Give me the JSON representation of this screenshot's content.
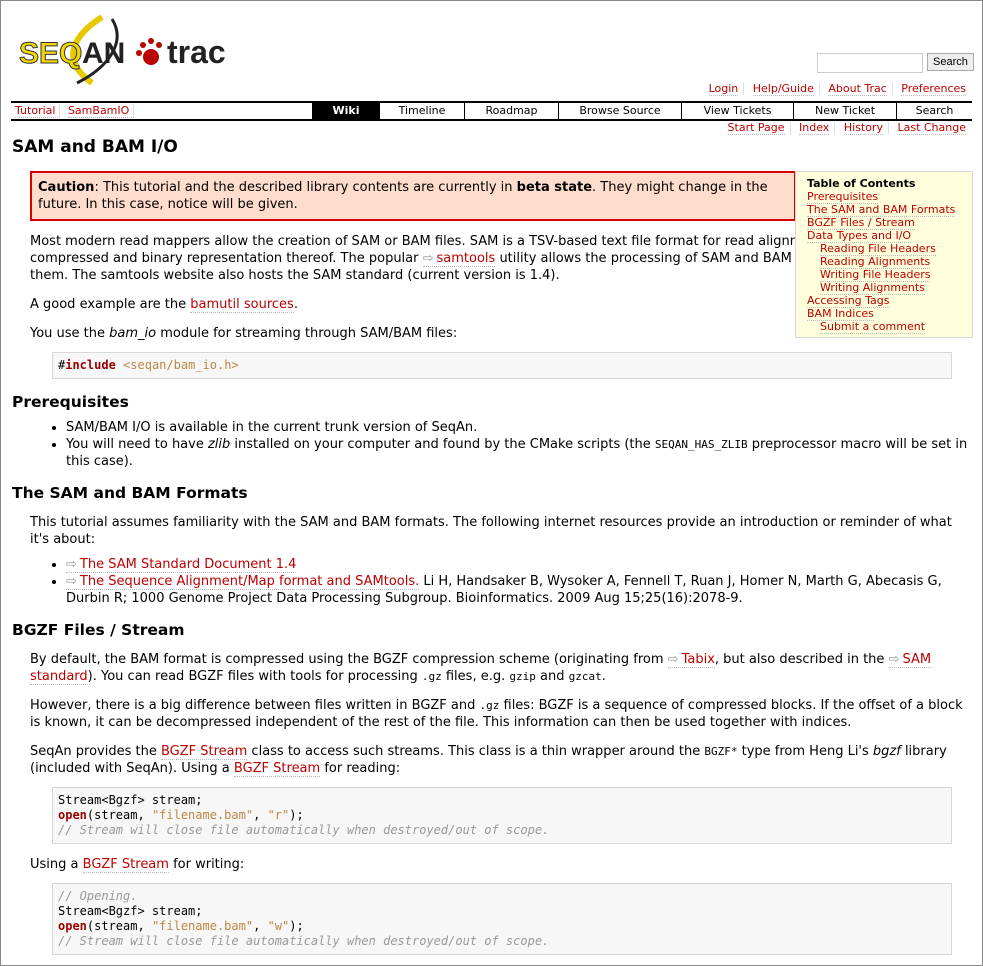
{
  "header": {
    "logo_text": "SEQAN trac",
    "search_button": "Search",
    "search_value": ""
  },
  "metanav": [
    "Login",
    "Help/Guide",
    "About Trac",
    "Preferences"
  ],
  "mainnav": {
    "left": [
      "Tutorial",
      "SamBamIO"
    ],
    "tabs": [
      "Wiki",
      "Timeline",
      "Roadmap",
      "Browse Source",
      "View Tickets",
      "New Ticket",
      "Search"
    ],
    "active": "Wiki"
  },
  "ctxnav": [
    "Start Page",
    "Index",
    "History",
    "Last Change"
  ],
  "title": "SAM and BAM I/O",
  "caution": [
    {
      "b": "Caution"
    },
    {
      "t": ": This tutorial and the described library contents are currently in "
    },
    {
      "b": "beta state"
    },
    {
      "t": ". They might change in the future. In this case, notice will be given."
    }
  ],
  "toc": {
    "heading": "Table of Contents",
    "items": [
      {
        "l": "Prerequisites"
      },
      {
        "l": "The SAM and BAM Formats"
      },
      {
        "l": "BGZF Files / Stream"
      },
      {
        "l": "Data Types and I/O"
      },
      {
        "l": "Reading File Headers",
        "i": 1
      },
      {
        "l": "Reading Alignments",
        "i": 1
      },
      {
        "l": "Writing File Headers",
        "i": 1
      },
      {
        "l": "Writing Alignments",
        "i": 1
      },
      {
        "l": "Accessing Tags"
      },
      {
        "l": "BAM Indices"
      },
      {
        "l": "Submit a comment",
        "i": 1
      }
    ]
  },
  "blocks": [
    {
      "k": "p",
      "s": [
        {
          "t": "Most modern read mappers allow the creation of SAM or BAM files. SAM is a TSV-based text file format for read alignments while BAM is a compressed and binary representation thereof. The popular "
        },
        {
          "x": "samtools"
        },
        {
          "t": " utility allows the processing of SAM and BAM files as well as indexing them. The samtools website also hosts the SAM standard (current version is 1.4)."
        }
      ]
    },
    {
      "k": "p",
      "s": [
        {
          "t": "A good example are the "
        },
        {
          "a": "bamutil sources"
        },
        {
          "t": "."
        }
      ]
    },
    {
      "k": "p",
      "s": [
        {
          "t": "You use the "
        },
        {
          "i": "bam_io"
        },
        {
          "t": " module for streaming through SAM/BAM files:"
        }
      ]
    },
    {
      "k": "pre",
      "s": [
        {
          "t": "#"
        },
        {
          "kw": "include"
        },
        {
          "t": " "
        },
        {
          "str": "<seqan/bam_io.h>"
        }
      ]
    },
    {
      "k": "h2",
      "s": [
        {
          "t": "Prerequisites"
        }
      ]
    },
    {
      "k": "ul",
      "items": [
        [
          {
            "t": "SAM/BAM I/O is available in the current trunk version of SeqAn."
          }
        ],
        [
          {
            "t": "You will need to have "
          },
          {
            "i": "zlib"
          },
          {
            "t": " installed on your computer and found by the CMake scripts (the "
          },
          {
            "c": "SEQAN_HAS_ZLIB"
          },
          {
            "t": " preprocessor macro will be set in this case)."
          }
        ]
      ]
    },
    {
      "k": "h2",
      "s": [
        {
          "t": "The SAM and BAM Formats"
        }
      ]
    },
    {
      "k": "p",
      "s": [
        {
          "t": "This tutorial assumes familiarity with the SAM and BAM formats. The following internet resources provide an introduction or reminder of what it's about:"
        }
      ]
    },
    {
      "k": "ul",
      "items": [
        [
          {
            "x": "The SAM Standard Document 1.4"
          }
        ],
        [
          {
            "x": "The Sequence Alignment/Map format and SAMtools."
          },
          {
            "t": " Li H, Handsaker B, Wysoker A, Fennell T, Ruan J, Homer N, Marth G, Abecasis G, Durbin R; 1000 Genome Project Data Processing Subgroup. Bioinformatics. 2009 Aug 15;25(16):2078-9."
          }
        ]
      ]
    },
    {
      "k": "h2",
      "s": [
        {
          "t": "BGZF Files / Stream"
        }
      ]
    },
    {
      "k": "p",
      "s": [
        {
          "t": "By default, the BAM format is compressed using the BGZF compression scheme (originating from "
        },
        {
          "x": "Tabix"
        },
        {
          "t": ", but also described in the "
        },
        {
          "x": "SAM standard"
        },
        {
          "t": "). You can read BGZF files with tools for processing "
        },
        {
          "c": ".gz"
        },
        {
          "t": " files, e.g. "
        },
        {
          "c": "gzip"
        },
        {
          "t": " and "
        },
        {
          "c": "gzcat"
        },
        {
          "t": "."
        }
      ]
    },
    {
      "k": "p",
      "s": [
        {
          "t": "However, there is a big difference between files written in BGZF and "
        },
        {
          "c": ".gz"
        },
        {
          "t": " files: BGZF is a sequence of compressed blocks. If the offset of a block is known, it can be decompressed independent of the rest of the file. This information can then be used together with indices."
        }
      ]
    },
    {
      "k": "p",
      "s": [
        {
          "t": "SeqAn provides the "
        },
        {
          "a": "BGZF Stream"
        },
        {
          "t": " class to access such streams. This class is a thin wrapper around the "
        },
        {
          "c": "BGZF*"
        },
        {
          "t": " type from Heng Li's "
        },
        {
          "i": "bgzf"
        },
        {
          "t": " library (included with SeqAn). Using a "
        },
        {
          "a": "BGZF Stream"
        },
        {
          "t": " for reading:"
        }
      ]
    },
    {
      "k": "pre",
      "s": [
        {
          "t": "Stream<Bgzf> stream;\n"
        },
        {
          "kw": "open"
        },
        {
          "t": "(stream, "
        },
        {
          "str": "\"filename.bam\""
        },
        {
          "t": ", "
        },
        {
          "str": "\"r\""
        },
        {
          "t": ");\n"
        },
        {
          "cm": "// Stream will close file automatically when destroyed/out of scope."
        }
      ]
    },
    {
      "k": "p",
      "s": [
        {
          "t": "Using a "
        },
        {
          "a": "BGZF Stream"
        },
        {
          "t": " for writing:"
        }
      ]
    },
    {
      "k": "pre",
      "s": [
        {
          "cm": "// Opening."
        },
        {
          "t": "\nStream<Bgzf> stream;\n"
        },
        {
          "kw": "open"
        },
        {
          "t": "(stream, "
        },
        {
          "str": "\"filename.bam\""
        },
        {
          "t": ", "
        },
        {
          "str": "\"w\""
        },
        {
          "t": ");\n"
        },
        {
          "cm": "// Stream will close file automatically when destroyed/out of scope."
        }
      ]
    }
  ]
}
